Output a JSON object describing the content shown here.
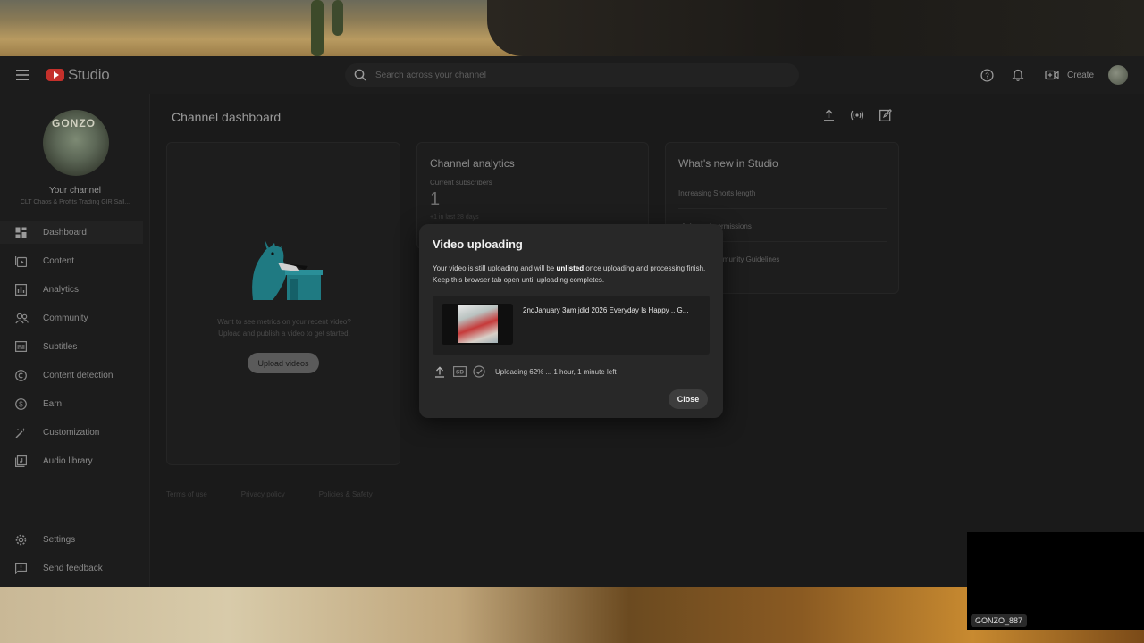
{
  "header": {
    "logo_text": "Studio",
    "search_placeholder": "Search across your channel",
    "create_label": "Create"
  },
  "sidebar": {
    "your_channel": "Your channel",
    "channel_name": "CLT Chaos & Profits Trading GIR Sall...",
    "avatar_text": "GONZO",
    "items": [
      {
        "label": "Dashboard",
        "icon": "dashboard-icon"
      },
      {
        "label": "Content",
        "icon": "content-icon"
      },
      {
        "label": "Analytics",
        "icon": "analytics-icon"
      },
      {
        "label": "Community",
        "icon": "community-icon"
      },
      {
        "label": "Subtitles",
        "icon": "subtitles-icon"
      },
      {
        "label": "Content detection",
        "icon": "copyright-icon"
      },
      {
        "label": "Earn",
        "icon": "dollar-icon"
      },
      {
        "label": "Customization",
        "icon": "magic-wand-icon"
      },
      {
        "label": "Audio library",
        "icon": "audio-library-icon"
      }
    ],
    "settings_label": "Settings",
    "feedback_label": "Send feedback"
  },
  "main": {
    "title": "Channel dashboard",
    "upload_card": {
      "empty_text_1": "Want to see metrics on your recent video?",
      "empty_text_2": "Upload and publish a video to get started.",
      "upload_button": "Upload videos"
    },
    "analytics_card": {
      "title": "Channel analytics",
      "subscribers_label": "Current subscribers",
      "subscribers_count": "1",
      "subscribers_change": "+1 in last 28 days"
    },
    "news_card": {
      "title": "What's new in Studio",
      "items": [
        "Increasing Shorts length",
        "of channel permissions",
        "anges to Community Guidelines"
      ]
    },
    "footer": [
      "Terms of use",
      "Privacy policy",
      "Policies & Safety"
    ]
  },
  "dialog": {
    "title": "Video uploading",
    "body_before": "Your video is still uploading and will be ",
    "body_bold": "unlisted",
    "body_after": " once uploading and processing finish. Keep this browser tab open until uploading completes.",
    "video_title": "2ndJanuary 3am jdid 2026 Everyday Is Happy .. G...",
    "status_text": "Uploading 62% ... 1 hour, 1 minute left",
    "upload_progress_percent": 62,
    "close_label": "Close"
  },
  "overlay": {
    "cam_label": "GONZO_887"
  }
}
